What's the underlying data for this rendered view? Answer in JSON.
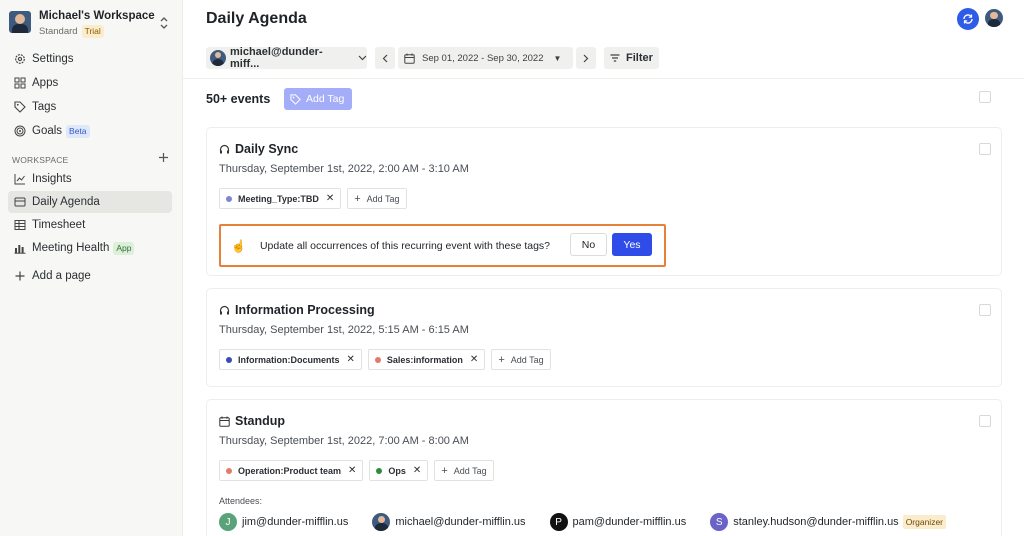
{
  "sidebar": {
    "workspace_name": "Michael's Workspace",
    "workspace_plan": "Standard",
    "plan_badge": "Trial",
    "items_top": [
      {
        "label": "Settings",
        "icon": "gear-icon"
      },
      {
        "label": "Apps",
        "icon": "grid-icon"
      },
      {
        "label": "Tags",
        "icon": "tag-icon"
      },
      {
        "label": "Goals",
        "icon": "target-icon",
        "badge": "Beta"
      }
    ],
    "workspace_label": "WORKSPACE",
    "items_ws": [
      {
        "label": "Insights",
        "icon": "chart-line-icon"
      },
      {
        "label": "Daily Agenda",
        "icon": "agenda-icon",
        "active": true
      },
      {
        "label": "Timesheet",
        "icon": "table-icon"
      },
      {
        "label": "Meeting Health",
        "icon": "bar-chart-icon",
        "badge": "App"
      }
    ],
    "add_page": "Add a page"
  },
  "header": {
    "title": "Daily Agenda"
  },
  "toolbar": {
    "user": "michael@dunder-miff...",
    "date_range": "Sep 01, 2022 - Sep 30, 2022",
    "filter": "Filter"
  },
  "summary": {
    "count": "50+ events",
    "add_tag": "Add Tag"
  },
  "events": [
    {
      "title": "Daily Sync",
      "time": "Thursday, September 1st, 2022, 2:00 AM - 3:10 AM",
      "tags": [
        {
          "label": "Meeting_Type:TBD",
          "color": "#7b86d6"
        }
      ],
      "add_tag": "Add Tag",
      "prompt": {
        "message": "Update all occurrences of this recurring event with these tags?",
        "no": "No",
        "yes": "Yes"
      }
    },
    {
      "title": "Information Processing",
      "time": "Thursday, September 1st, 2022, 5:15 AM - 6:15 AM",
      "tags": [
        {
          "label": "Information:Documents",
          "color": "#3a4bb8"
        },
        {
          "label": "Sales:information",
          "color": "#e47a6a"
        }
      ],
      "add_tag": "Add Tag"
    },
    {
      "title": "Standup",
      "time": "Thursday, September 1st, 2022, 7:00 AM - 8:00 AM",
      "tags": [
        {
          "label": "Operation:Product team",
          "color": "#e47a6a"
        },
        {
          "label": "Ops",
          "color": "#2e8b3e"
        }
      ],
      "add_tag": "Add Tag",
      "attendees_label": "Attendees:",
      "attendees": [
        {
          "initial": "J",
          "email": "jim@dunder-mifflin.us",
          "color": "#5aa37a"
        },
        {
          "initial": "",
          "email": "michael@dunder-mifflin.us",
          "color": "#3e5a7e"
        },
        {
          "initial": "P",
          "email": "pam@dunder-mifflin.us",
          "color": "#111111"
        },
        {
          "initial": "S",
          "email": "stanley.hudson@dunder-mifflin.us",
          "color": "#6a63c8",
          "badge": "Organizer"
        }
      ]
    }
  ]
}
